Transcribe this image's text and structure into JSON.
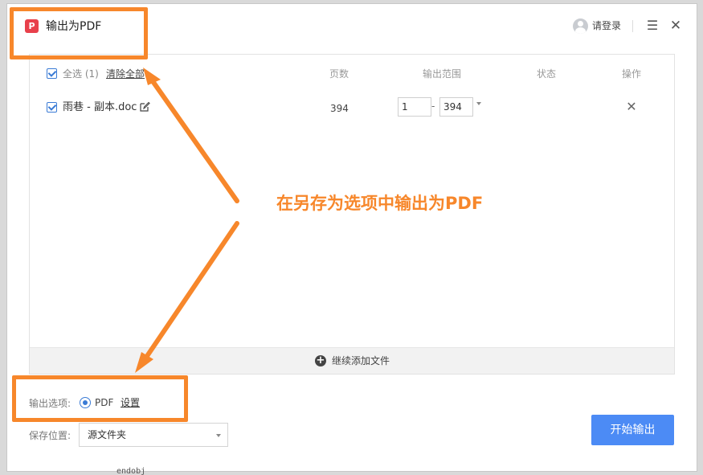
{
  "window": {
    "title": "输出为PDF",
    "logo_char": "P"
  },
  "header": {
    "login_label": "请登录"
  },
  "table": {
    "select_all_label": "全选 (1)",
    "clear_all_label": "清除全部",
    "columns": {
      "pages": "页数",
      "range": "输出范围",
      "status": "状态",
      "action": "操作"
    },
    "rows": [
      {
        "file_name": "雨巷 - 副本.doc",
        "pages": "394",
        "range_start": "1",
        "range_end": "394",
        "checked": true
      }
    ]
  },
  "add_bar": {
    "label": "继续添加文件"
  },
  "options": {
    "label": "输出选项:",
    "format_label": "PDF",
    "settings_label": "设置"
  },
  "save": {
    "label": "保存位置:",
    "value": "源文件夹"
  },
  "start_button": {
    "label": "开始输出"
  },
  "annotation": {
    "text": "在另存为选项中输出为PDF"
  },
  "background_text": {
    "text": "endobj"
  },
  "colors": {
    "accent": "#3a7bd5",
    "highlight": "#f7872b",
    "button": "#4c8bf5",
    "logo": "#e8404b"
  },
  "icons": [
    "pdf-logo-icon",
    "user-avatar-icon",
    "menu-icon",
    "close-icon",
    "edit-icon",
    "remove-icon",
    "add-icon",
    "chevron-down-icon"
  ]
}
